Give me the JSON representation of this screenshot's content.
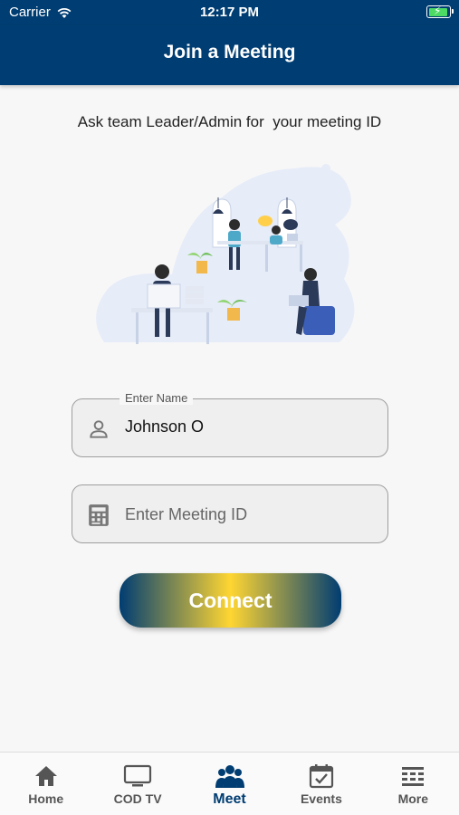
{
  "status_bar": {
    "carrier": "Carrier",
    "time": "12:17 PM"
  },
  "header": {
    "title": "Join a Meeting"
  },
  "hint_text": "Ask team Leader/Admin for  your meeting ID",
  "name_field": {
    "label": "Enter Name",
    "value": "Johnson O",
    "icon": "person-icon"
  },
  "meeting_field": {
    "placeholder": "Enter Meeting ID",
    "value": "",
    "icon": "calculator-icon"
  },
  "connect_button": {
    "label": "Connect"
  },
  "tab_bar": {
    "items": [
      {
        "label": "Home",
        "icon": "home-icon",
        "active": false
      },
      {
        "label": "COD TV",
        "icon": "tv-icon",
        "active": false
      },
      {
        "label": "Meet",
        "icon": "people-icon",
        "active": true
      },
      {
        "label": "Events",
        "icon": "calendar-check-icon",
        "active": false
      },
      {
        "label": "More",
        "icon": "grid-icon",
        "active": false
      }
    ]
  },
  "colors": {
    "primary": "#003d72",
    "accent": "#ffd632",
    "battery": "#4cd964"
  }
}
